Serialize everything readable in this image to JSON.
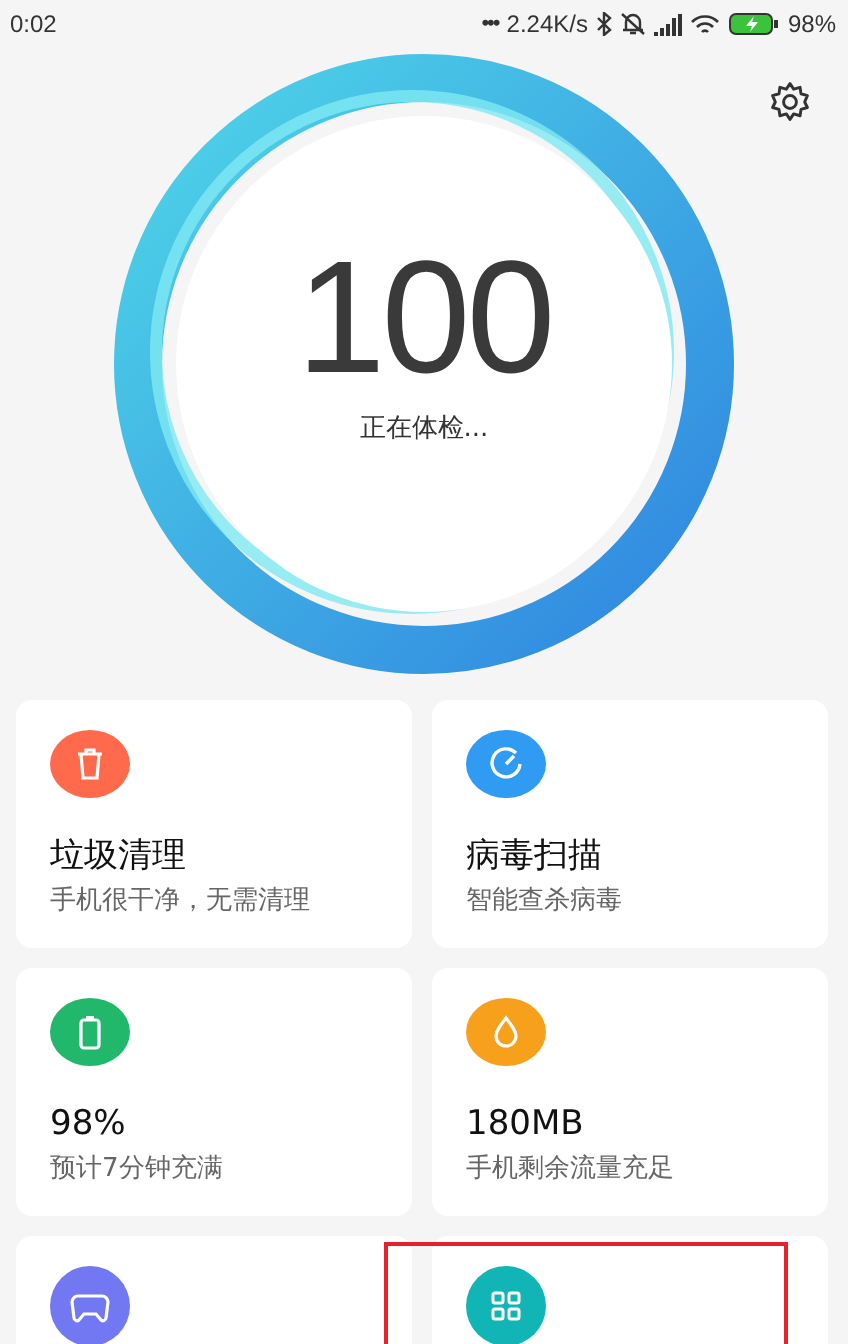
{
  "status_bar": {
    "time": "0:02",
    "dots": "•••",
    "speed": "2.24K/s",
    "battery_text": "98%"
  },
  "score": {
    "value": "100",
    "caption": "正在体检..."
  },
  "cards": [
    {
      "kind": "trash",
      "color": "#ff6a4d",
      "title": "垃圾清理",
      "subtitle": "手机很干净，无需清理"
    },
    {
      "kind": "gauge",
      "color": "#2f9bf2",
      "title": "病毒扫描",
      "subtitle": "智能查杀病毒"
    },
    {
      "kind": "battery",
      "color": "#22b86c",
      "title": "98%",
      "subtitle": "预计7分钟充满"
    },
    {
      "kind": "drop",
      "color": "#f7a01c",
      "title": "180MB",
      "subtitle": "手机剩余流量充足"
    },
    {
      "kind": "gamepad",
      "color": "#7178f2"
    },
    {
      "kind": "grid",
      "color": "#12b5b5"
    }
  ]
}
